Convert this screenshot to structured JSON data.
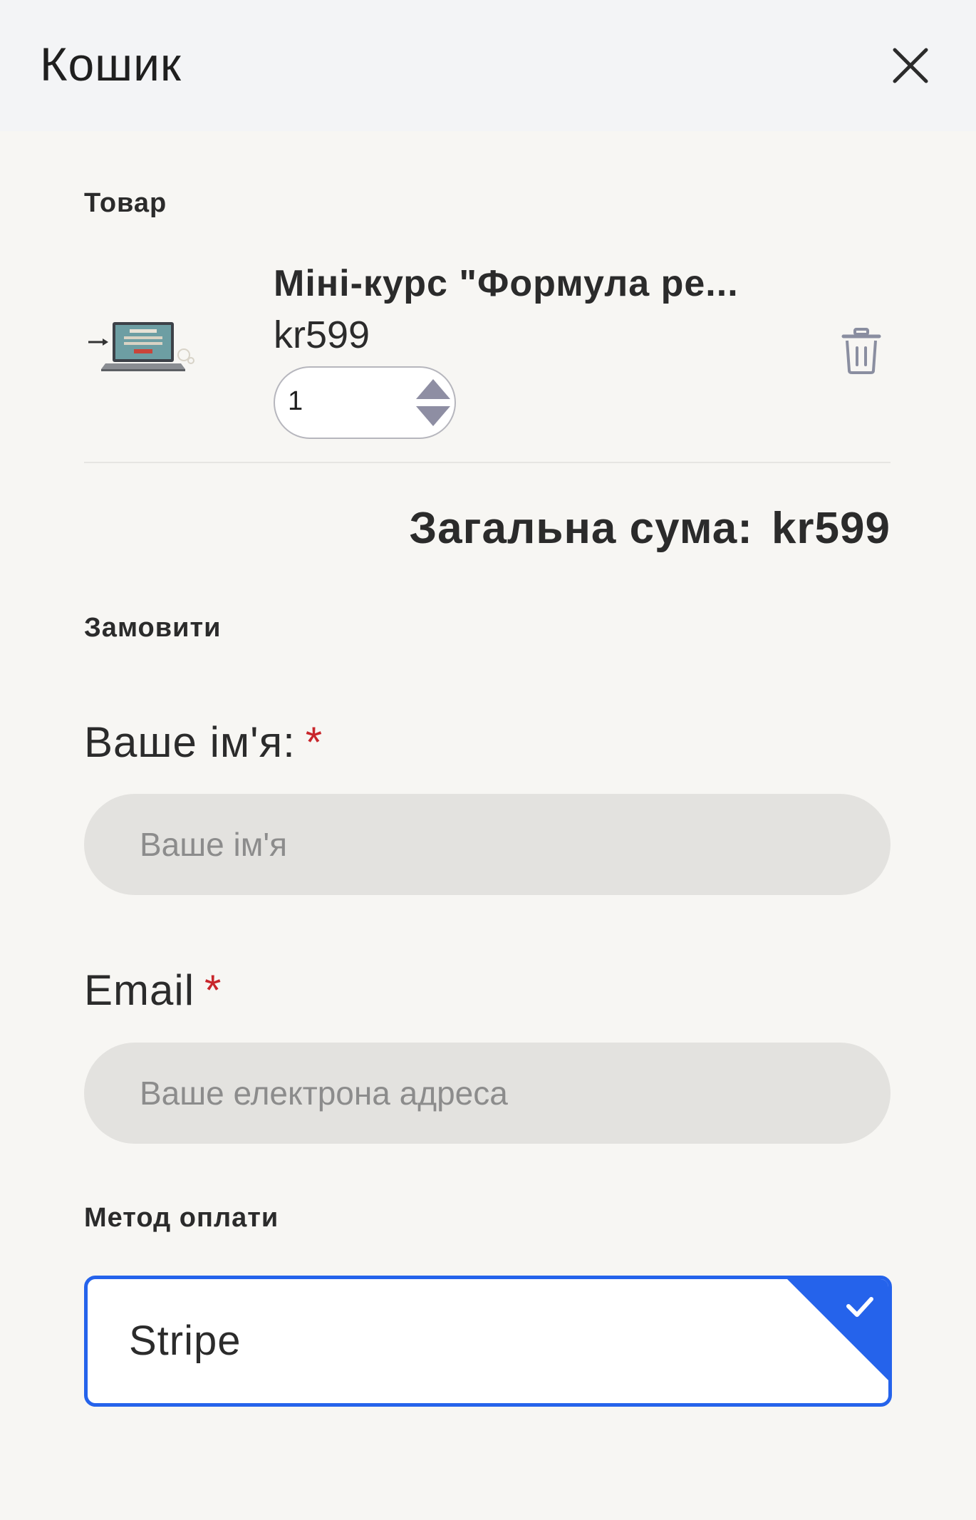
{
  "header": {
    "title": "Кошик"
  },
  "cart": {
    "section_label": "Товар",
    "item": {
      "name": "Міні-курс \"Формула ре...",
      "price": "kr599",
      "quantity": "1"
    },
    "total_label": "Загальна сума:",
    "total_value": "kr599"
  },
  "order": {
    "section_label": "Замовити",
    "name_label": "Ваше ім'я:",
    "name_required": "*",
    "name_placeholder": "Ваше ім'я",
    "email_label": "Email",
    "email_required": "*",
    "email_placeholder": "Ваше електрона адреса"
  },
  "payment": {
    "section_label": "Метод оплати",
    "selected_method": "Stripe"
  },
  "colors": {
    "accent": "#2563eb",
    "required": "#c8262b"
  }
}
